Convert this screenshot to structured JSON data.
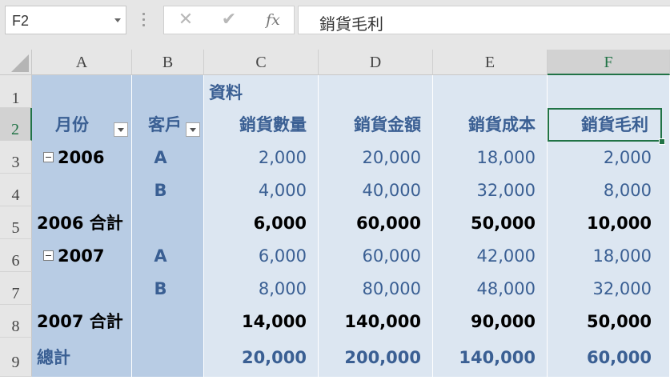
{
  "name_box": {
    "value": "F2"
  },
  "formula_bar": {
    "cancel_glyph": "✕",
    "enter_glyph": "✔",
    "fx_label": "fx",
    "content": "銷貨毛利"
  },
  "corner": {},
  "columns": [
    "A",
    "B",
    "C",
    "D",
    "E",
    "F"
  ],
  "rows": [
    "1",
    "2",
    "3",
    "4",
    "5",
    "6",
    "7",
    "8",
    "9"
  ],
  "pivot": {
    "data_label": "資料",
    "headers": {
      "month": "月份",
      "customer": "客戶",
      "sales_qty": "銷貨數量",
      "sales_amount": "銷貨金額",
      "sales_cost": "銷貨成本",
      "gross_profit": "銷貨毛利"
    },
    "body": [
      {
        "month": "2006",
        "customer": "A",
        "qty": "2,000",
        "amount": "20,000",
        "cost": "18,000",
        "profit": "2,000",
        "kind": "detail",
        "collapse": true
      },
      {
        "month": "",
        "customer": "B",
        "qty": "4,000",
        "amount": "40,000",
        "cost": "32,000",
        "profit": "8,000",
        "kind": "detail",
        "collapse": false
      },
      {
        "month": "2006 合計",
        "customer": "",
        "qty": "6,000",
        "amount": "60,000",
        "cost": "50,000",
        "profit": "10,000",
        "kind": "subtotal",
        "collapse": false
      },
      {
        "month": "2007",
        "customer": "A",
        "qty": "6,000",
        "amount": "60,000",
        "cost": "42,000",
        "profit": "18,000",
        "kind": "detail",
        "collapse": true
      },
      {
        "month": "",
        "customer": "B",
        "qty": "8,000",
        "amount": "80,000",
        "cost": "48,000",
        "profit": "32,000",
        "kind": "detail",
        "collapse": false
      },
      {
        "month": "2007 合計",
        "customer": "",
        "qty": "14,000",
        "amount": "140,000",
        "cost": "90,000",
        "profit": "50,000",
        "kind": "subtotal",
        "collapse": false
      },
      {
        "month": "總計",
        "customer": "",
        "qty": "20,000",
        "amount": "200,000",
        "cost": "140,000",
        "profit": "60,000",
        "kind": "grandtotal",
        "collapse": false
      }
    ]
  },
  "selection": {
    "active_cell": "F2"
  },
  "colors": {
    "row_label_fill": "#b8cce4",
    "value_fill": "#dce6f1",
    "text_blue": "#3a5f93",
    "selection_green": "#217346"
  }
}
